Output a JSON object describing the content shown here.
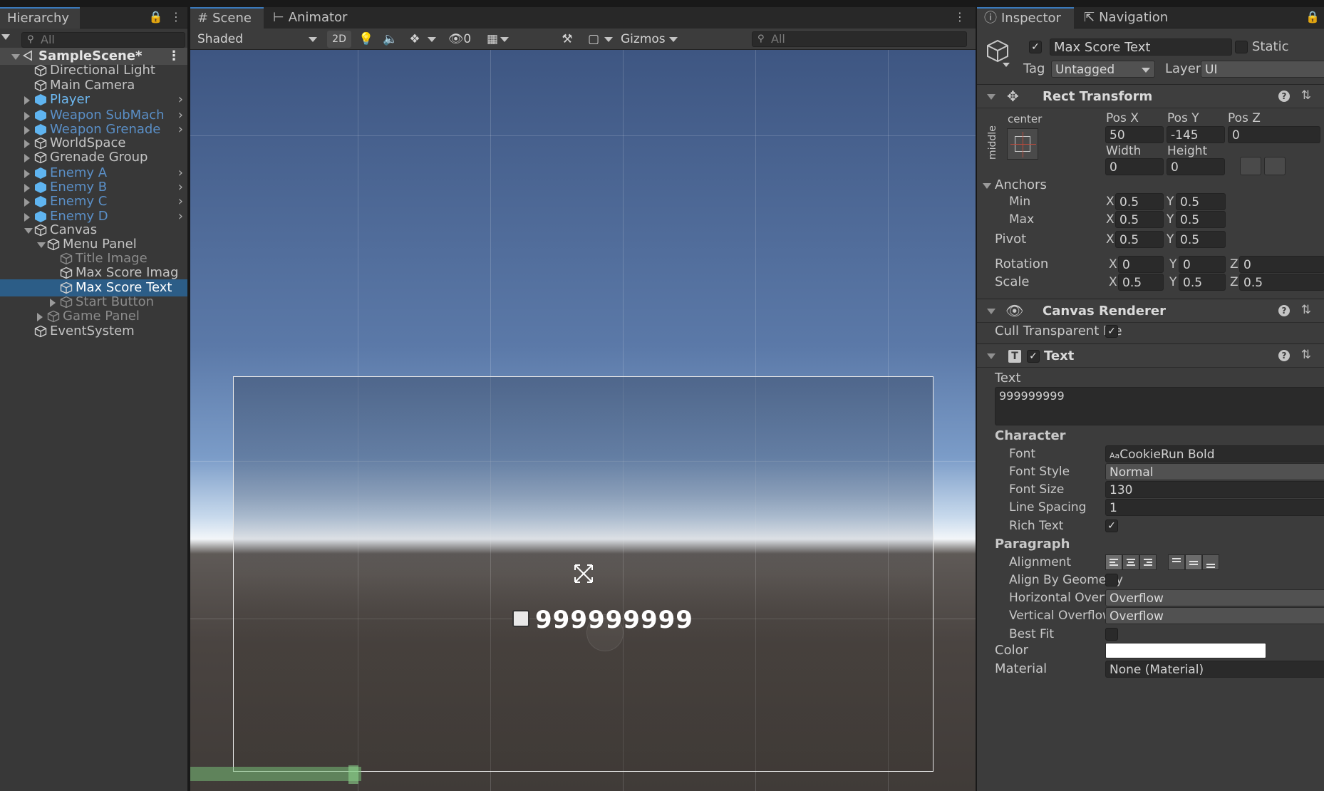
{
  "hierarchy": {
    "tab_label": "Hierarchy",
    "search_placeholder": "All",
    "scene_name": "SampleScene*",
    "items": [
      {
        "label": "Directional Light"
      },
      {
        "label": "Main Camera"
      },
      {
        "label": "Player"
      },
      {
        "label": "Weapon SubMach"
      },
      {
        "label": "Weapon Grenade"
      },
      {
        "label": "WorldSpace"
      },
      {
        "label": "Grenade Group"
      },
      {
        "label": "Enemy A"
      },
      {
        "label": "Enemy B"
      },
      {
        "label": "Enemy C"
      },
      {
        "label": "Enemy D"
      },
      {
        "label": "Canvas"
      },
      {
        "label": "Menu Panel"
      },
      {
        "label": "Title Image"
      },
      {
        "label": "Max Score Imag"
      },
      {
        "label": "Max Score Text"
      },
      {
        "label": "Start Button"
      },
      {
        "label": "Game Panel"
      },
      {
        "label": "EventSystem"
      }
    ]
  },
  "scene": {
    "tabs": [
      {
        "label": "Scene"
      },
      {
        "label": "Animator"
      }
    ],
    "toolbar": {
      "shading_mode": "Shaded",
      "mode_2d": "2D",
      "hidden_count": "0",
      "gizmos": "Gizmos",
      "search_placeholder": "All"
    },
    "viewport": {
      "score_text": "999999999"
    }
  },
  "inspector": {
    "tabs": [
      {
        "label": "Inspector"
      },
      {
        "label": "Navigation"
      }
    ],
    "object_name": "Max Score Text",
    "static_label": "Static",
    "tag_label": "Tag",
    "tag_value": "Untagged",
    "layer_label": "Layer",
    "layer_value": "UI",
    "rect_transform": {
      "title": "Rect Transform",
      "anchor_h": "center",
      "anchor_v": "middle",
      "pos_x_label": "Pos X",
      "pos_x": "50",
      "pos_y_label": "Pos Y",
      "pos_y": "-145",
      "pos_z_label": "Pos Z",
      "pos_z": "0",
      "width_label": "Width",
      "width": "0",
      "height_label": "Height",
      "height": "0",
      "anchors_label": "Anchors",
      "min_label": "Min",
      "min_x": "0.5",
      "min_y": "0.5",
      "max_label": "Max",
      "max_x": "0.5",
      "max_y": "0.5",
      "pivot_label": "Pivot",
      "pivot_x": "0.5",
      "pivot_y": "0.5",
      "rotation_label": "Rotation",
      "rot_x": "0",
      "rot_y": "0",
      "rot_z": "0",
      "scale_label": "Scale",
      "scale_x": "0.5",
      "scale_y": "0.5",
      "scale_z": "0.5",
      "axis_x": "X",
      "axis_y": "Y",
      "axis_z": "Z"
    },
    "canvas_renderer": {
      "title": "Canvas Renderer",
      "cull_label": "Cull Transparent Me"
    },
    "text": {
      "title": "Text",
      "text_label": "Text",
      "text_value": "999999999",
      "character_label": "Character",
      "font_label": "Font",
      "font_value": "CookieRun Bold",
      "font_prefix": "Aa",
      "font_style_label": "Font Style",
      "font_style_value": "Normal",
      "font_size_label": "Font Size",
      "font_size_value": "130",
      "line_spacing_label": "Line Spacing",
      "line_spacing_value": "1",
      "rich_text_label": "Rich Text",
      "paragraph_label": "Paragraph",
      "alignment_label": "Alignment",
      "align_geometry_label": "Align By Geometry",
      "h_overflow_label": "Horizontal Overflo",
      "h_overflow_value": "Overflow",
      "v_overflow_label": "Vertical Overflow",
      "v_overflow_value": "Overflow",
      "best_fit_label": "Best Fit",
      "color_label": "Color",
      "color_value": "#ffffff",
      "material_label": "Material",
      "material_value": "None (Material)"
    }
  }
}
